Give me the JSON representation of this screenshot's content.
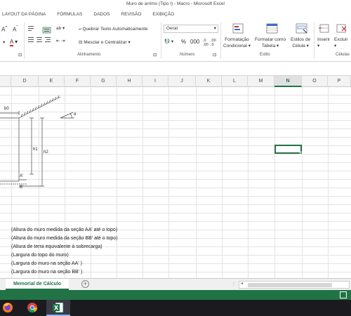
{
  "window": {
    "title": "Muro de arrimo (Tipo I) - Macro - Microsoft Excel"
  },
  "ribbon_tabs": [
    "LAYOUT DA PÁGINA",
    "FÓRMULAS",
    "DADOS",
    "REVISÃO",
    "EXIBIÇÃO"
  ],
  "ribbon": {
    "wrap_text": "Quebrar Texto Automaticamente",
    "merge_center": "Mesclar e Centralizar",
    "number_format": "Geral",
    "conditional_format": "Formatação",
    "conditional_format_2": "Condicional",
    "format_table": "Formatar como",
    "format_table_2": "Tabela",
    "cell_styles": "Estilos de",
    "cell_styles_2": "Célula",
    "insert": "Inserir",
    "delete": "Excluir",
    "group_alignment": "Alinhamento",
    "group_number": "Número",
    "group_styles": "Estilo",
    "group_cells": "Células"
  },
  "columns": [
    "D",
    "E",
    "F",
    "G",
    "H",
    "I",
    "J",
    "K",
    "L",
    "M",
    "N",
    "O",
    "P"
  ],
  "selected_column": "N",
  "drawing_labels": {
    "b0": "b0",
    "alpha": "α",
    "h1": "h1",
    "h2": "h2",
    "a_prime": "A'",
    "b_prime": "B'"
  },
  "cell_notes": [
    "(Altura do muro medida da seção AA' até o topo)",
    "(Altura do muro medida da seção BB' até o topo)",
    "(Altura de terra equivalente à sobrecarga)",
    "(Largura do topo do muro)",
    "(Largura do muro na seção AA' )",
    "(Largura do muro na seção BB' )"
  ],
  "sheet_tab": "Memorial de Cálculo",
  "colors": {
    "excel_green": "#217346",
    "taskbar": "#1b1b1f"
  },
  "taskbar_icons": [
    "firefox-icon",
    "chrome-icon",
    "excel-icon"
  ]
}
